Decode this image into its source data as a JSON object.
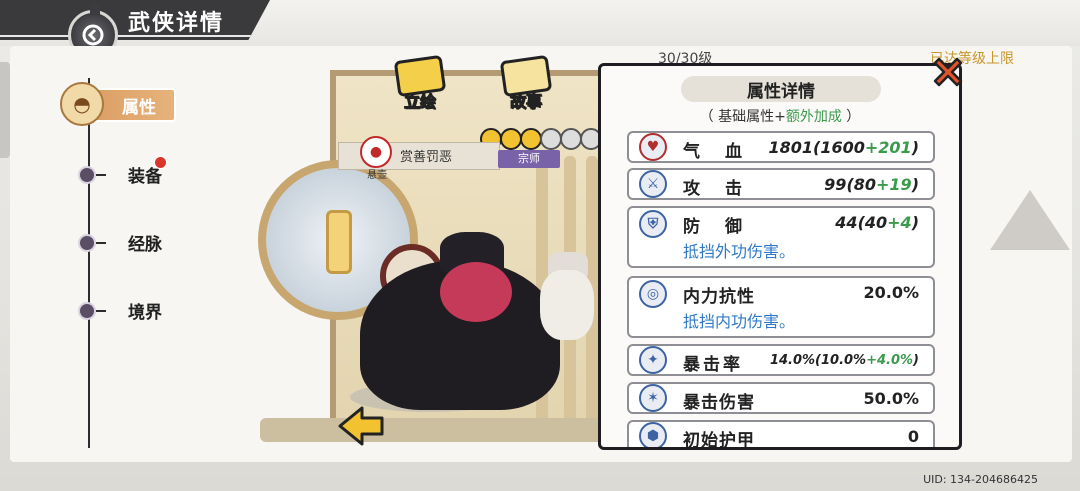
{
  "header": {
    "title": "武侠详情"
  },
  "nav": {
    "items": [
      {
        "label": "属性",
        "active": true
      },
      {
        "label": "装备",
        "badge": true
      },
      {
        "label": "经脉"
      },
      {
        "label": "境界"
      }
    ]
  },
  "tabs": {
    "portrait": "立绘",
    "story": "故事"
  },
  "level": {
    "text": "30/30级",
    "limit": "已达等级上限"
  },
  "hero": {
    "title": "赏善罚恶",
    "emblem": "悬壶",
    "rank": "宗师"
  },
  "panel": {
    "title": "属性详情",
    "subtitle_prefix": "（ 基础属性+",
    "subtitle_bonus": "额外加成",
    "subtitle_suffix": " ）",
    "stats": [
      {
        "name": "气　血",
        "value": "1801(1600",
        "bonus": "+201",
        "close": ")",
        "icon": "heart-icon"
      },
      {
        "name": "攻　击",
        "value": "99(80",
        "bonus": "+19",
        "close": ")",
        "icon": "sword-icon"
      },
      {
        "name": "防　御",
        "value": "44(40",
        "bonus": "+4",
        "close": ")",
        "desc": "抵挡外功伤害。",
        "icon": "shield-icon"
      },
      {
        "name": "内力抗性",
        "value": "20.0%",
        "desc": "抵挡内功伤害。",
        "icon": "swirl-icon"
      },
      {
        "name": "暴击率",
        "value": "14.0%(10.0%",
        "bonus": "+4.0%",
        "close": ")",
        "icon": "crit-icon"
      },
      {
        "name": "暴击伤害",
        "value": "50.0%",
        "icon": "crit-damage-icon"
      },
      {
        "name": "初始护甲",
        "value": "0",
        "icon": "armor-icon"
      }
    ]
  },
  "footer": {
    "uid": "UID: 134-204686425"
  },
  "colors": {
    "accent": "#d99a5e",
    "bonus": "#3b9a4c",
    "desc": "#2f79c8",
    "rank": "#7a62a8"
  }
}
